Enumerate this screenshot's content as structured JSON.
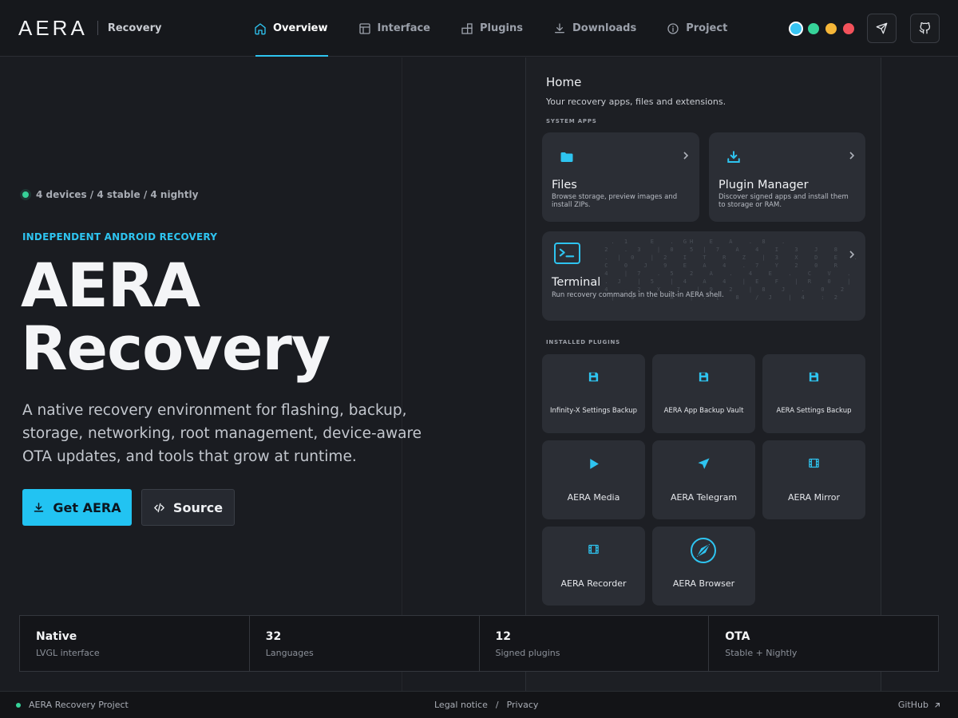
{
  "header": {
    "logo": "AERA",
    "subtitle": "Recovery",
    "nav": [
      {
        "label": "Overview",
        "icon": "home-icon",
        "active": true
      },
      {
        "label": "Interface",
        "icon": "layout-icon"
      },
      {
        "label": "Plugins",
        "icon": "blocks-icon"
      },
      {
        "label": "Downloads",
        "icon": "download-icon"
      },
      {
        "label": "Project",
        "icon": "info-icon"
      }
    ],
    "theme_dots": [
      "#38c5f3",
      "#36d399",
      "#f5b638",
      "#f3525b"
    ],
    "buttons": [
      "telegram-icon",
      "github-icon"
    ]
  },
  "hero": {
    "status": "4 devices / 4 stable / 4 nightly",
    "eyebrow": "INDEPENDENT ANDROID RECOVERY",
    "title_line1": "AERA",
    "title_line2": "Recovery",
    "description": "A native recovery environment for flashing, backup, storage, networking, root management, device-aware OTA updates, and tools that grow at runtime.",
    "primary_button": "Get AERA",
    "secondary_button": "Source"
  },
  "device": {
    "title": "Home",
    "subtitle": "Your recovery apps, files and extensions.",
    "system_label": "SYSTEM APPS",
    "system_apps": [
      {
        "title": "Files",
        "desc": "Browse storage, preview images and install ZIPs.",
        "icon": "folder-icon"
      },
      {
        "title": "Plugin Manager",
        "desc": "Discover signed apps and install them to storage or RAM.",
        "icon": "download-tray-icon"
      },
      {
        "title": "Terminal",
        "desc": "Run recovery commands in the built-in AERA shell.",
        "icon": "terminal-icon"
      }
    ],
    "plugins_label": "INSTALLED PLUGINS",
    "plugins": [
      {
        "label": "Infinity-X Settings Backup",
        "icon": "save-icon"
      },
      {
        "label": "AERA App Backup Vault",
        "icon": "save-icon"
      },
      {
        "label": "AERA Settings Backup",
        "icon": "save-icon"
      },
      {
        "label": "AERA Media",
        "icon": "play-icon"
      },
      {
        "label": "AERA Telegram",
        "icon": "send-icon"
      },
      {
        "label": "AERA Mirror",
        "icon": "film-icon"
      },
      {
        "label": "AERA Recorder",
        "icon": "film-icon"
      },
      {
        "label": "AERA Browser",
        "icon": "compass-icon"
      }
    ]
  },
  "stats": [
    {
      "value": "Native",
      "label": "LVGL interface"
    },
    {
      "value": "32",
      "label": "Languages"
    },
    {
      "value": "12",
      "label": "Signed plugins"
    },
    {
      "value": "OTA",
      "label": "Stable + Nightly"
    }
  ],
  "footer": {
    "project": "AERA Recovery Project",
    "legal": "Legal notice",
    "sep": "/",
    "privacy": "Privacy",
    "github": "GitHub"
  }
}
